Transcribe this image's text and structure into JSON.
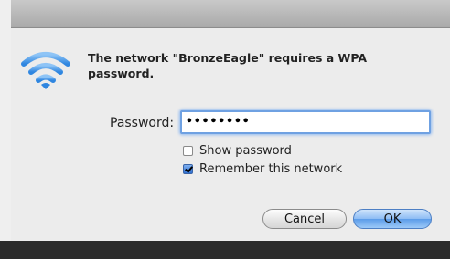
{
  "dialog": {
    "message": "The network \"BronzeEagle\" requires a WPA password.",
    "password_label": "Password:",
    "password_value": "••••••••",
    "show_password": {
      "label": "Show password",
      "checked": false
    },
    "remember_network": {
      "label": "Remember this network",
      "checked": true
    },
    "cancel_label": "Cancel",
    "ok_label": "OK",
    "icon": "wifi-icon",
    "accent_color": "#6fa1e2"
  }
}
